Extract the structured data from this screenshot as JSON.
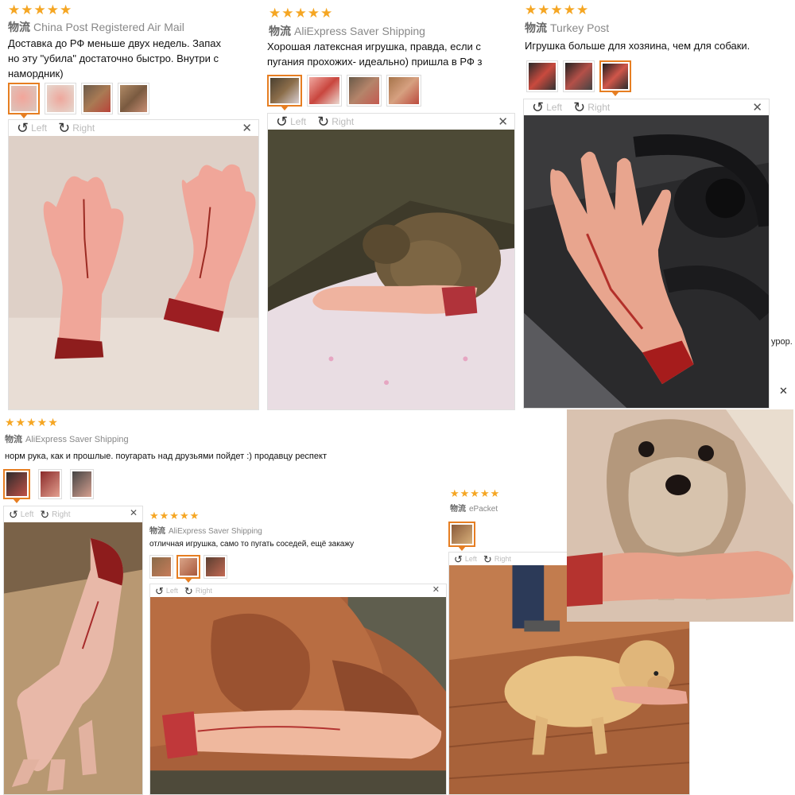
{
  "viewer": {
    "left_label": "Left",
    "right_label": "Right",
    "close_glyph": "✕"
  },
  "reviews": [
    {
      "stars": "★★★★★",
      "shipping_prefix": "物流",
      "shipping": "China Post Registered Air Mail",
      "text": "Доставка до РФ меньше двух недель. Запах\nно эту \"убила\" достаточно быстро. Внутри с\nнамордник)",
      "thumbs": [
        "hands",
        "hands",
        "dog",
        "dog"
      ]
    },
    {
      "stars": "★★★★★",
      "shipping_prefix": "物流",
      "shipping": "AliExpress Saver Shipping",
      "text": "Хорошая латексная игрушка, правда, если с\nпугания прохожих- идеально) пришла в РФ з",
      "thumbs": [
        "dog",
        "hands",
        "dog",
        "dog"
      ]
    },
    {
      "stars": "★★★★★",
      "shipping_prefix": "物流",
      "shipping": "Turkey Post",
      "text": "Игрушка больше для хозяина, чем для собаки.",
      "thumbs": [
        "hands",
        "car",
        "car"
      ],
      "side_text": "урор."
    },
    {
      "stars": "★★★★★",
      "shipping_prefix": "物流",
      "shipping": "AliExpress Saver Shipping",
      "text": "норм рука, как и прошлые. поугарать над друзьями пойдет :) продавцу респект",
      "thumbs": [
        "hands",
        "hands",
        "hands"
      ]
    },
    {
      "stars": "★★★★★",
      "shipping_prefix": "物流",
      "shipping": "AliExpress Saver Shipping",
      "text": "отличная игрушка, само то пугать соседей, ещё закажу",
      "thumbs": [
        "dog",
        "hands",
        "dog"
      ]
    },
    {
      "stars": "★★★★★",
      "shipping_prefix": "物流",
      "shipping": "ePacket",
      "text": "",
      "thumbs": [
        "dog"
      ]
    }
  ]
}
